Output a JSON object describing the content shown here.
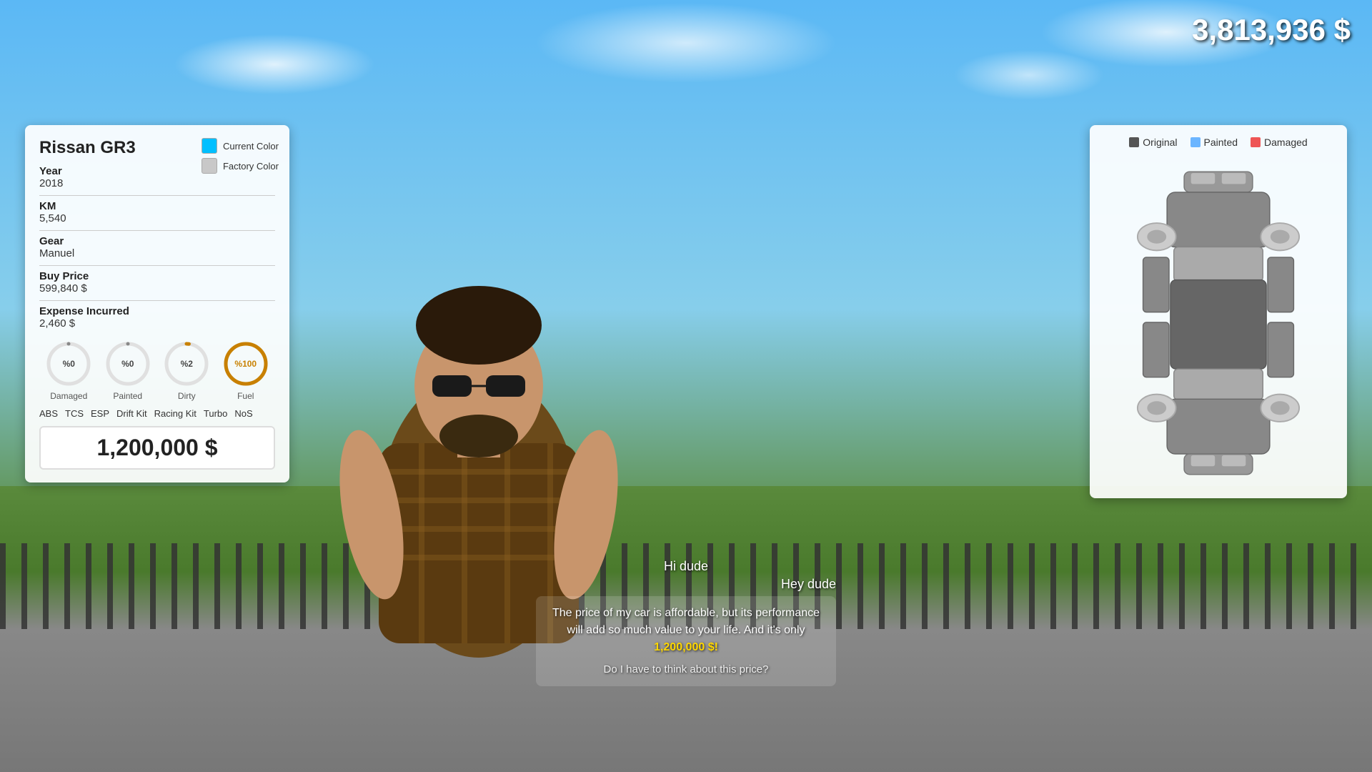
{
  "hud": {
    "money": "3,813,936 $"
  },
  "car_info": {
    "title": "Rissan GR3",
    "current_color_label": "Current Color",
    "factory_color_label": "Factory Color",
    "current_color_hex": "#00BFFF",
    "factory_color_hex": "#C8C8C8",
    "year_label": "Year",
    "year_value": "2018",
    "km_label": "KM",
    "km_value": "5,540",
    "gear_label": "Gear",
    "gear_value": "Manuel",
    "buy_price_label": "Buy Price",
    "buy_price_value": "599,840 $",
    "expense_label": "Expense Incurred",
    "expense_value": "2,460 $",
    "gauges": [
      {
        "label": "Damaged",
        "value": "%0",
        "color": "#888",
        "percent": 0
      },
      {
        "label": "Painted",
        "value": "%0",
        "color": "#888",
        "percent": 0
      },
      {
        "label": "Dirty",
        "value": "%2",
        "color": "#888",
        "percent": 2
      },
      {
        "label": "Fuel",
        "value": "%100",
        "color": "#C88000",
        "percent": 100
      }
    ],
    "mods": [
      "ABS",
      "TCS",
      "ESP",
      "Drift Kit",
      "Racing Kit",
      "Turbo",
      "NoS"
    ],
    "listing_price": "1,200,000 $"
  },
  "car_diagram": {
    "legend": [
      {
        "label": "Original",
        "color": "#555"
      },
      {
        "label": "Painted",
        "color": "#6BB5FF"
      },
      {
        "label": "Damaged",
        "color": "#E55"
      }
    ]
  },
  "dialog": {
    "player_text": "Hi dude",
    "npc_text": "Hey dude",
    "npc_pitch": "The price of my car is affordable, but its performance will add so much value to your life. And it's only 1,200,000 $!",
    "npc_highlight": "1,200,000 $!",
    "npc_question": "Do I have to think about this price?"
  }
}
